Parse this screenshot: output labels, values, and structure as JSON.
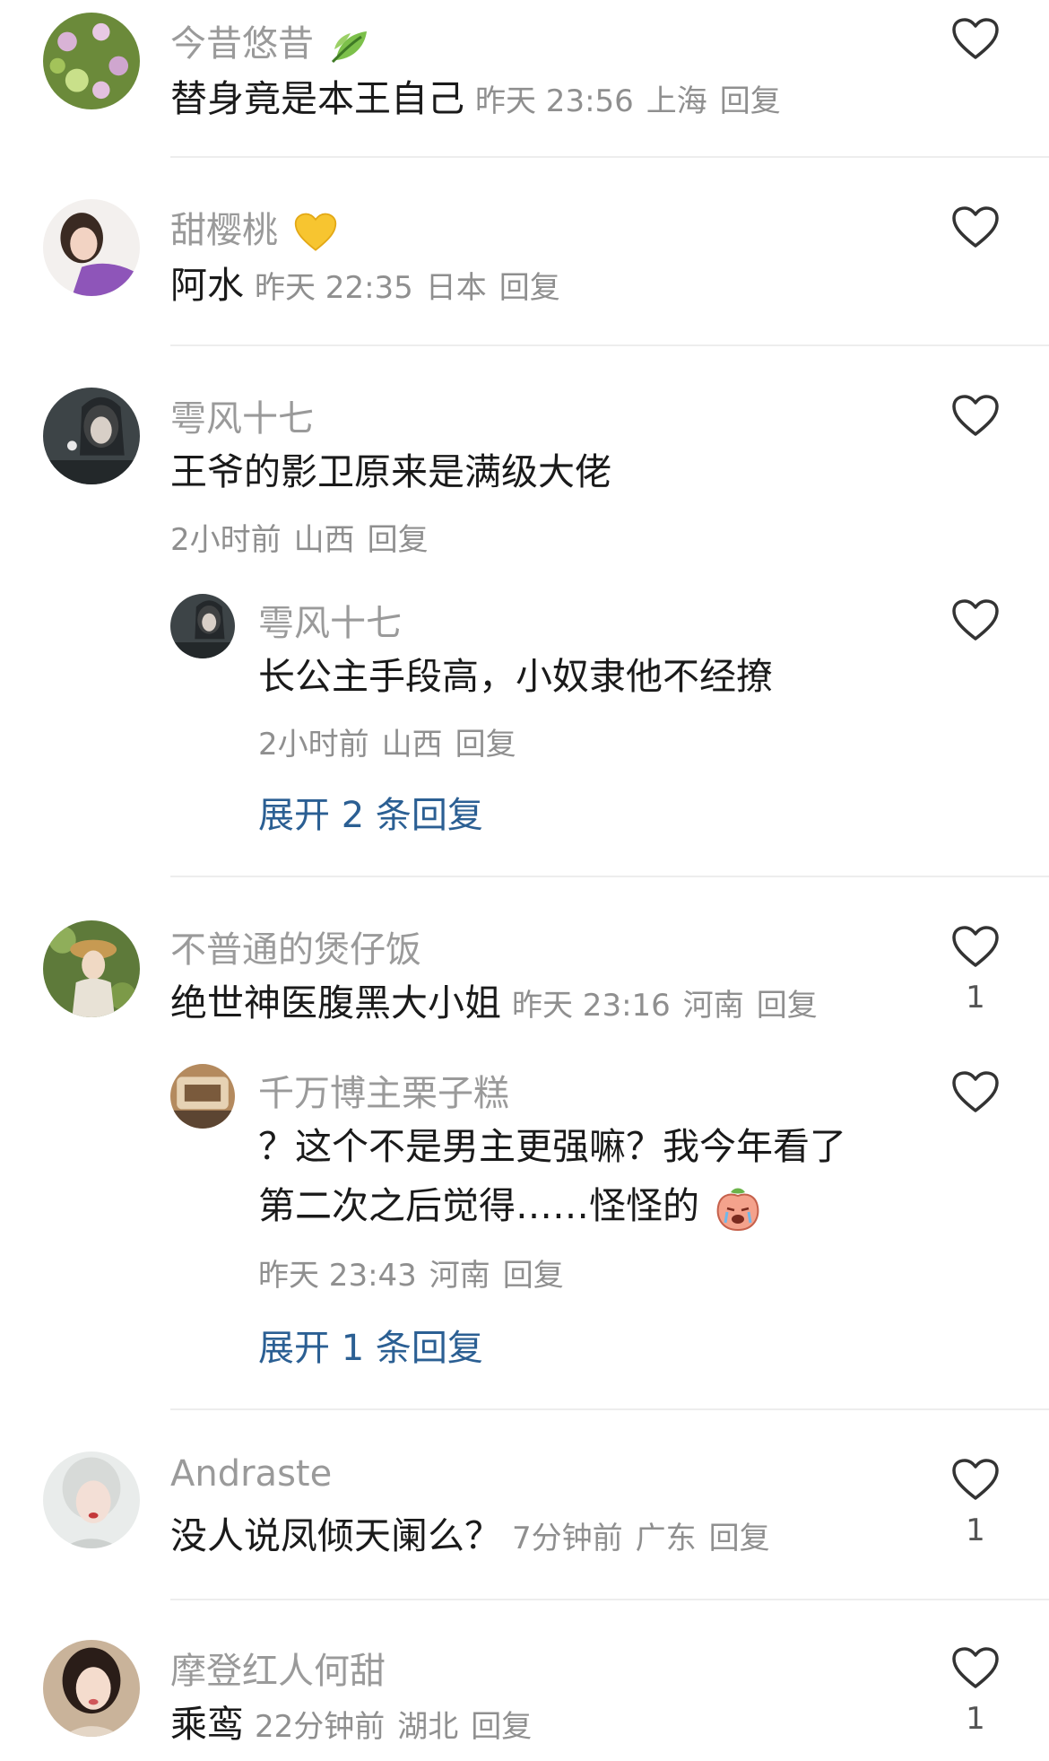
{
  "comments": [
    {
      "name": "今昔悠昔",
      "name_icon": "leaf-emoji-icon",
      "text": "替身竟是本王自己",
      "time": "昨天 23:56",
      "location": "上海",
      "reply": "回复",
      "likes": ""
    },
    {
      "name": "甜樱桃",
      "name_icon": "yellow-heart-emoji-icon",
      "text": "阿水",
      "time": "昨天 22:35",
      "location": "日本",
      "reply": "回复",
      "likes": ""
    },
    {
      "name": "雩风十七",
      "text": "王爷的影卫原来是满级大佬",
      "time": "2小时前",
      "location": "山西",
      "reply": "回复",
      "likes": "",
      "sub_reply": {
        "name": "雩风十七",
        "text": "长公主手段高，小奴隶他不经撩",
        "time": "2小时前",
        "location": "山西",
        "reply": "回复"
      },
      "expand": "展开 2 条回复"
    },
    {
      "name": "不普通的煲仔饭",
      "text": "绝世神医腹黑大小姐",
      "time": "昨天 23:16",
      "location": "河南",
      "reply": "回复",
      "likes": "1",
      "sub_reply": {
        "name": "千万博主栗子糕",
        "text_line1": "？这个不是男主更强嘛？我今年看了",
        "text_line2": "第二次之后觉得……怪怪的",
        "text_icon": "crying-peach-emoji-icon",
        "time": "昨天 23:43",
        "location": "河南",
        "reply": "回复"
      },
      "expand": "展开 1 条回复"
    },
    {
      "name": "Andraste",
      "text": "没人说凤倾天阑么？",
      "time": "7分钟前",
      "location": "广东",
      "reply": "回复",
      "likes": "1"
    },
    {
      "name": "摩登红人何甜",
      "text": "乘鸾",
      "time": "22分钟前",
      "location": "湖北",
      "reply": "回复",
      "likes": "1"
    }
  ],
  "colors": {
    "name": "#9a9a9a",
    "text": "#1a1a1a",
    "meta": "#8f8f8f",
    "expand_link": "#2b5f93",
    "heart_outline": "#333333"
  }
}
